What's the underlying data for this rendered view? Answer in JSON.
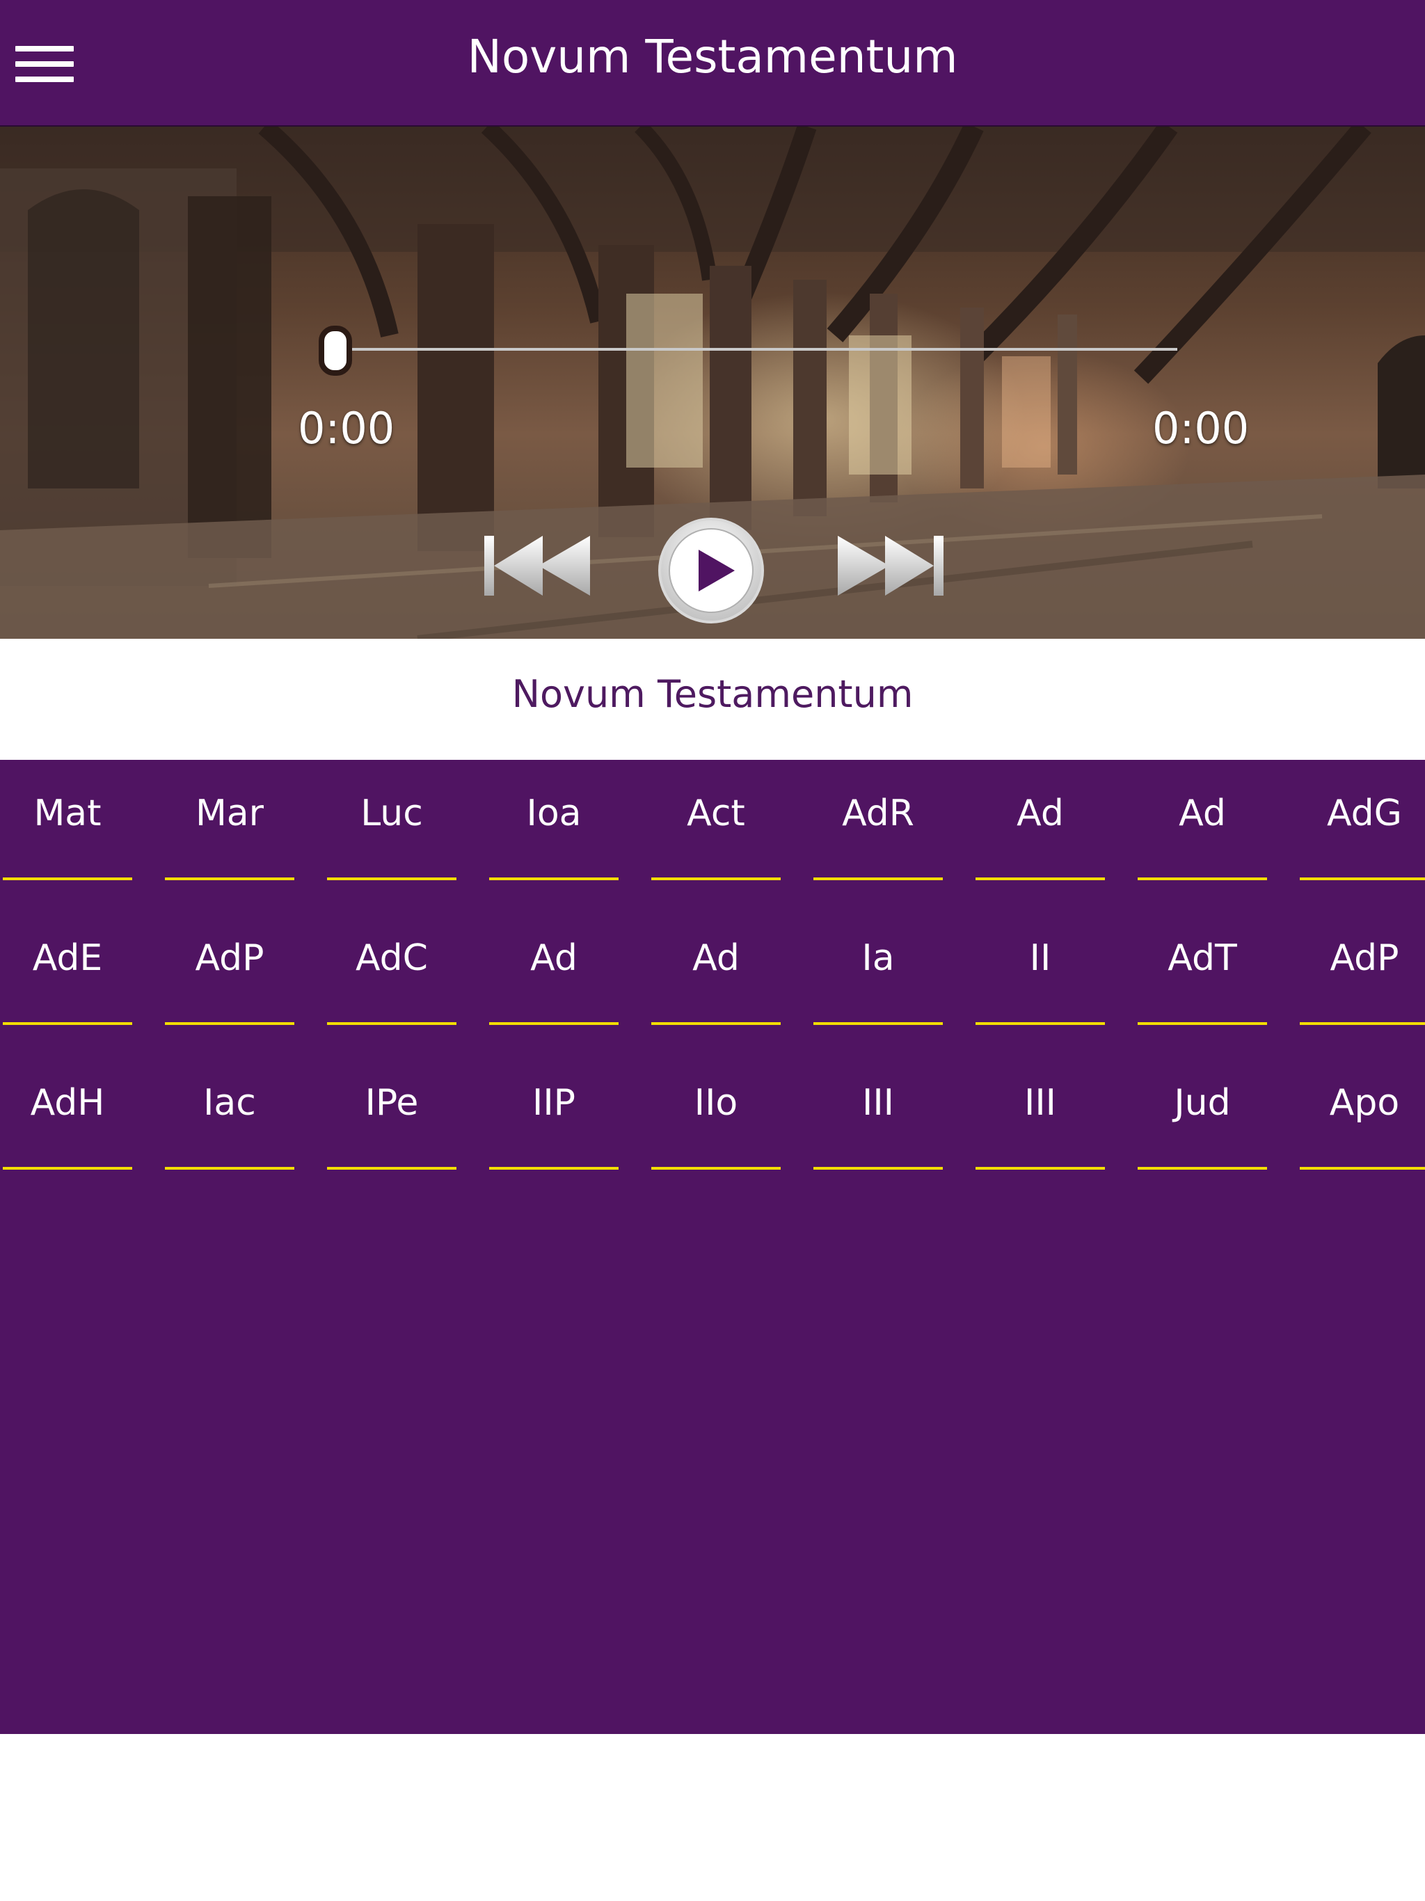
{
  "app_bar": {
    "title": "Novum Testamentum",
    "menu_icon": "hamburger-menu-icon"
  },
  "player": {
    "elapsed": "0:00",
    "total": "0:00",
    "progress": 0,
    "controls": {
      "previous_icon": "skip-previous-icon",
      "play_icon": "play-icon",
      "next_icon": "skip-next-icon"
    }
  },
  "section_title": "Novum Testamentum",
  "books": [
    "Mat",
    "Mar",
    "Luc",
    "Ioa",
    "Act",
    "AdR",
    "Ad",
    "Ad",
    "AdG",
    "AdE",
    "AdP",
    "AdC",
    "Ad",
    "Ad",
    "Ia",
    "II",
    "AdT",
    "AdP",
    "AdH",
    "Iac",
    "IPe",
    "IIP",
    "IIo",
    "III",
    "III",
    "Jud",
    "Apo"
  ],
  "colors": {
    "primary": "#501462",
    "accent_underline": "#f3dd00",
    "title_text": "#4e1a60"
  }
}
